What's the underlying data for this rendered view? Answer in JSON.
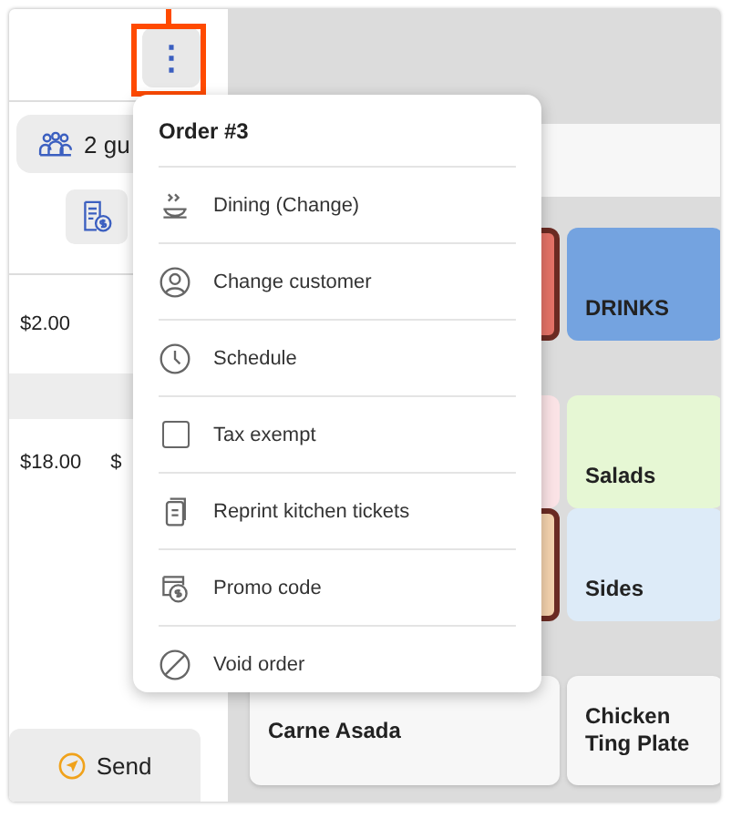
{
  "order_panel": {
    "more_button": {
      "icon": "⋮",
      "highlighted": true
    },
    "guests": "2 gu",
    "lines": [
      {
        "price": "$2.00"
      },
      {
        "price": "$18.00",
        "total": "$"
      }
    ],
    "send_button": "Send"
  },
  "tiles": [
    {
      "color": "#e57368",
      "selected": true
    },
    {
      "label": "DRINKS",
      "color": "#74a3e0",
      "selected": false
    },
    {
      "color": "#fbe3e6",
      "selected": false
    },
    {
      "label": "Salads",
      "color": "#e6f7d4",
      "selected": false
    },
    {
      "color": "#f5d3ae",
      "selected": true
    },
    {
      "label": "Sides",
      "color": "#ddebf8",
      "selected": false
    },
    {
      "label": "Carne Asada",
      "color": "#f7f7f7",
      "selected": false
    },
    {
      "label": "Chicken Ting Plate",
      "color": "#f7f7f7",
      "selected": false
    }
  ],
  "menu": {
    "title": "Order #3",
    "items": [
      {
        "label": "Dining (Change)",
        "kind": "action"
      },
      {
        "label": "Change customer",
        "kind": "action"
      },
      {
        "label": "Schedule",
        "kind": "action"
      },
      {
        "label": "Tax exempt",
        "kind": "checkbox",
        "checked": false
      },
      {
        "label": "Reprint kitchen tickets",
        "kind": "action"
      },
      {
        "label": "Promo code",
        "kind": "action"
      },
      {
        "label": "Void order",
        "kind": "action"
      }
    ]
  }
}
